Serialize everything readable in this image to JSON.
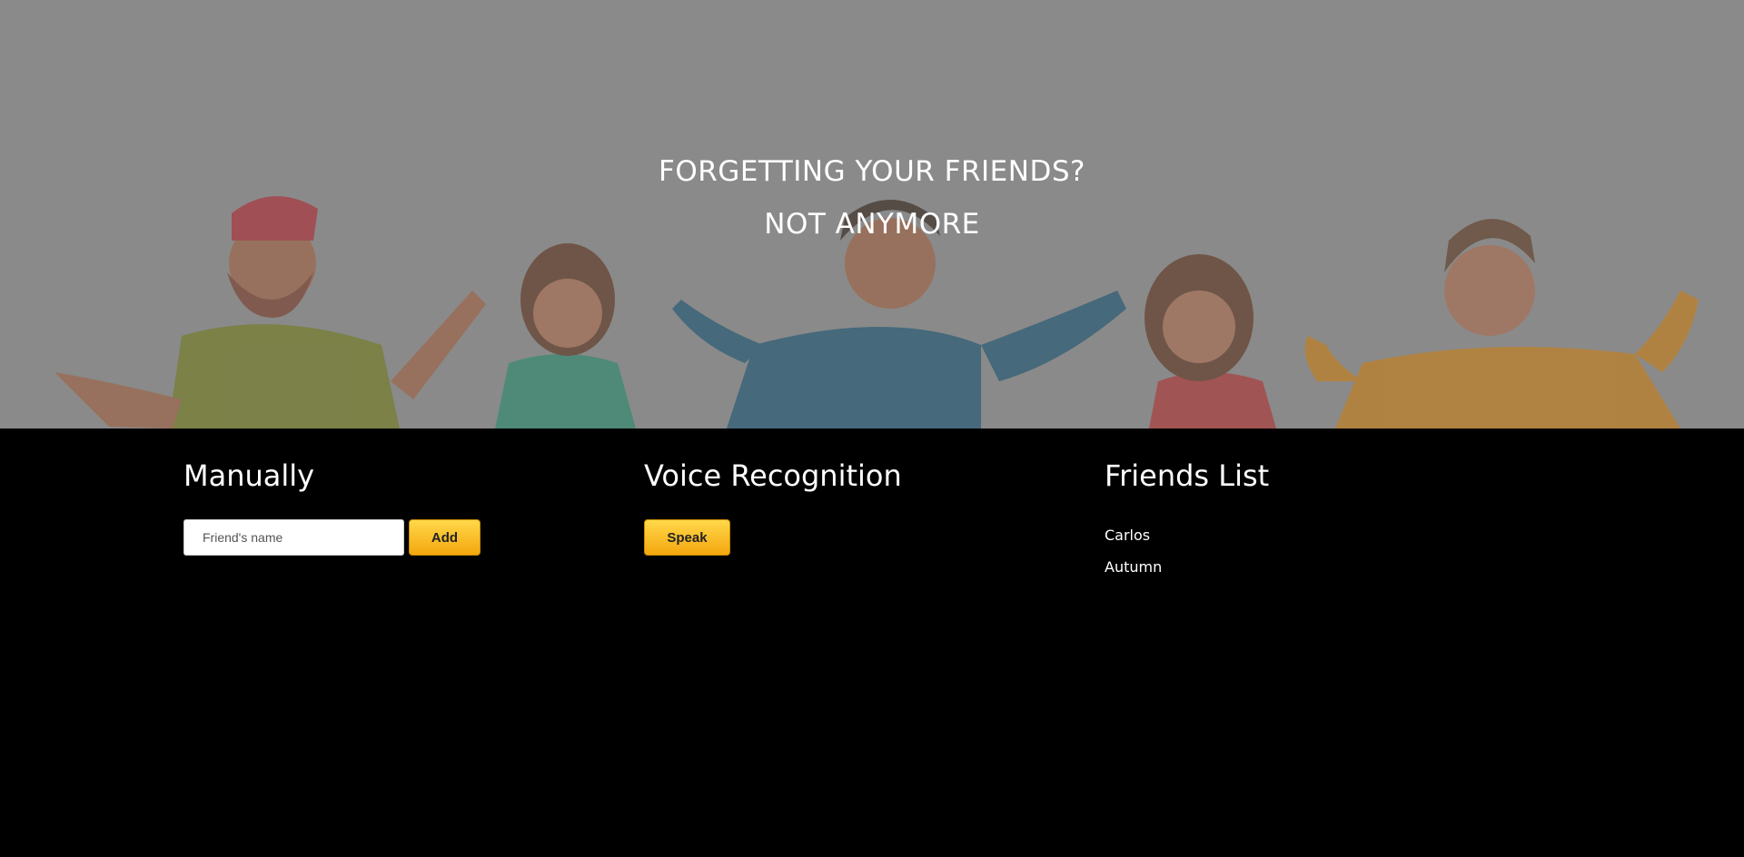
{
  "hero": {
    "line1": "FORGETTING YOUR FRIENDS?",
    "line2": "NOT ANYMORE",
    "background_color": "#8a8a8a"
  },
  "manual": {
    "title": "Manually",
    "input_placeholder": "Friend's name",
    "input_value": "",
    "add_label": "Add"
  },
  "voice": {
    "title": "Voice Recognition",
    "speak_label": "Speak"
  },
  "friends": {
    "title": "Friends List",
    "items": [
      "Carlos",
      "Autumn"
    ]
  },
  "colors": {
    "accent": "#f9c12c",
    "page_background": "#000000"
  }
}
